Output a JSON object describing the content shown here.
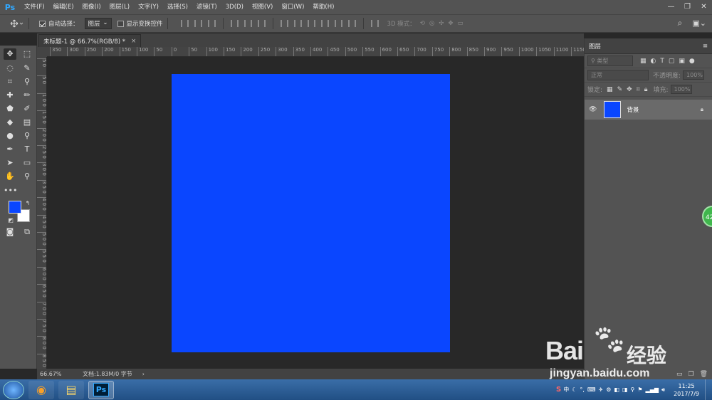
{
  "app": {
    "logo": "Ps"
  },
  "menubar": {
    "items": [
      "文件(F)",
      "编辑(E)",
      "图像(I)",
      "图层(L)",
      "文字(Y)",
      "选择(S)",
      "滤镜(T)",
      "3D(D)",
      "视图(V)",
      "窗口(W)",
      "帮助(H)"
    ],
    "win_minimize": "—",
    "win_restore": "❐",
    "win_close": "✕"
  },
  "options": {
    "auto_select_label": "自动选择：",
    "auto_select_checked": true,
    "auto_select_value": "图层",
    "show_transform_label": "显示变换控件",
    "mode_3d_label": "3D 模式："
  },
  "document": {
    "tab_title": "未标题-1 @ 66.7%(RGB/8) *",
    "close_icon": "×",
    "canvas_color": "#0a46ff"
  },
  "ruler": {
    "h_labels": [
      "350",
      "300",
      "250",
      "200",
      "150",
      "100",
      "50",
      "0",
      "50",
      "100",
      "150",
      "200",
      "250",
      "300",
      "350",
      "400",
      "450",
      "500",
      "550",
      "600",
      "650",
      "700",
      "750",
      "800",
      "850",
      "900",
      "950",
      "1000",
      "1050",
      "1100",
      "1150"
    ],
    "v_labels": [
      "5 0",
      "5 0",
      "1 0 0",
      "1 5 0",
      "2 0 0",
      "2 5 0",
      "3 0 0",
      "3 5 0",
      "4 0 0",
      "4 5 0",
      "5 0 0",
      "5 5 0",
      "6 0 0",
      "6 5 0",
      "7 0 0",
      "7 5 0",
      "8 0 0",
      "8 5 0"
    ]
  },
  "status": {
    "zoom": "66.67%",
    "doc_info": "文档:1.83M/0 字节",
    "arrow": "›"
  },
  "tools": {
    "colors": {
      "foreground": "#0a46ff",
      "background": "#ffffff"
    }
  },
  "layers_panel": {
    "title": "图层",
    "filter_label": "类型",
    "blend_mode": "正常",
    "opacity_label": "不透明度:",
    "opacity_value": "100%",
    "lock_label": "锁定:",
    "fill_label": "填充:",
    "fill_value": "100%",
    "layers": [
      {
        "name": "背景",
        "visible": true,
        "locked": true
      }
    ]
  },
  "watermark": {
    "brand": "Bai",
    "brand2": "经验",
    "url": "jingyan.baidu.com"
  },
  "bubble": {
    "text": "42"
  },
  "taskbar": {
    "ps_label": "Ps",
    "ime": "中",
    "time": "11:25",
    "date": "2017/7/9"
  }
}
